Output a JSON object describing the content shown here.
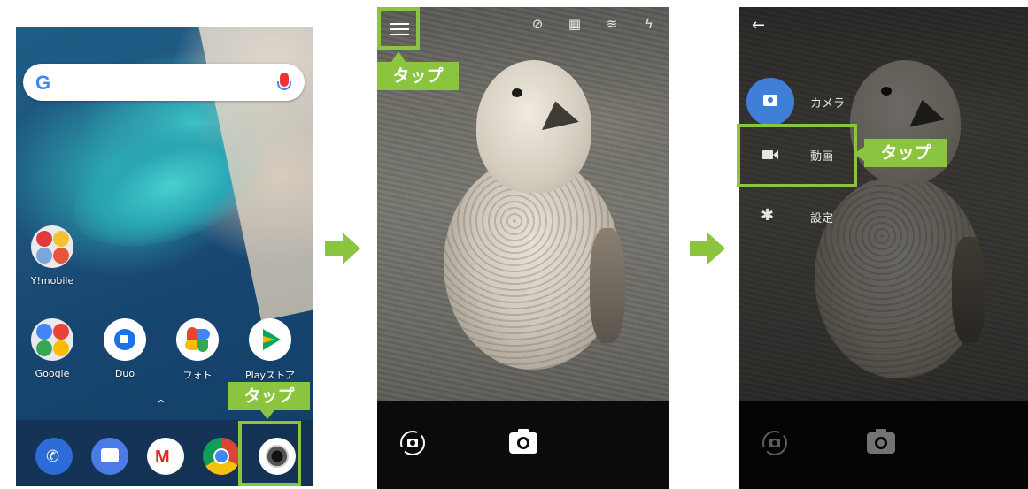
{
  "annotations": {
    "tap_label": "タップ",
    "accent": "#8bc53f"
  },
  "home": {
    "search": {
      "logo": "G"
    },
    "apps": [
      {
        "label": "Y!mobile"
      },
      {
        "label": "Google"
      },
      {
        "label": "Duo"
      },
      {
        "label": "フォト"
      },
      {
        "label": "Playストア"
      }
    ],
    "dock_icons": [
      "phone-icon",
      "messages-icon",
      "gmail-icon",
      "chrome-icon",
      "camera-app-icon"
    ]
  },
  "camera": {
    "top_icons": [
      "timer-off-icon",
      "grid-off-icon",
      "hdr-off-icon",
      "flash-auto-icon"
    ]
  },
  "menu": {
    "items": [
      {
        "label": "カメラ",
        "icon": "camera-icon"
      },
      {
        "label": "動画",
        "icon": "video-icon"
      },
      {
        "label": "設定",
        "icon": "gear-icon"
      }
    ]
  }
}
